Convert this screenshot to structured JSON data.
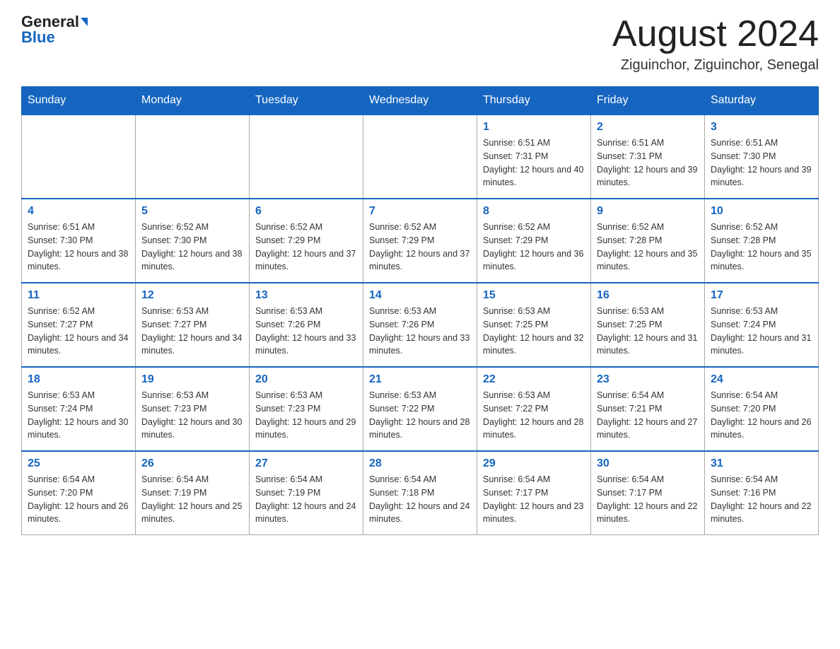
{
  "header": {
    "logo_general": "General",
    "logo_blue": "Blue",
    "month_title": "August 2024",
    "location": "Ziguinchor, Ziguinchor, Senegal"
  },
  "days_of_week": [
    "Sunday",
    "Monday",
    "Tuesday",
    "Wednesday",
    "Thursday",
    "Friday",
    "Saturday"
  ],
  "weeks": [
    {
      "days": [
        {
          "number": "",
          "info": ""
        },
        {
          "number": "",
          "info": ""
        },
        {
          "number": "",
          "info": ""
        },
        {
          "number": "",
          "info": ""
        },
        {
          "number": "1",
          "info": "Sunrise: 6:51 AM\nSunset: 7:31 PM\nDaylight: 12 hours and 40 minutes."
        },
        {
          "number": "2",
          "info": "Sunrise: 6:51 AM\nSunset: 7:31 PM\nDaylight: 12 hours and 39 minutes."
        },
        {
          "number": "3",
          "info": "Sunrise: 6:51 AM\nSunset: 7:30 PM\nDaylight: 12 hours and 39 minutes."
        }
      ]
    },
    {
      "days": [
        {
          "number": "4",
          "info": "Sunrise: 6:51 AM\nSunset: 7:30 PM\nDaylight: 12 hours and 38 minutes."
        },
        {
          "number": "5",
          "info": "Sunrise: 6:52 AM\nSunset: 7:30 PM\nDaylight: 12 hours and 38 minutes."
        },
        {
          "number": "6",
          "info": "Sunrise: 6:52 AM\nSunset: 7:29 PM\nDaylight: 12 hours and 37 minutes."
        },
        {
          "number": "7",
          "info": "Sunrise: 6:52 AM\nSunset: 7:29 PM\nDaylight: 12 hours and 37 minutes."
        },
        {
          "number": "8",
          "info": "Sunrise: 6:52 AM\nSunset: 7:29 PM\nDaylight: 12 hours and 36 minutes."
        },
        {
          "number": "9",
          "info": "Sunrise: 6:52 AM\nSunset: 7:28 PM\nDaylight: 12 hours and 35 minutes."
        },
        {
          "number": "10",
          "info": "Sunrise: 6:52 AM\nSunset: 7:28 PM\nDaylight: 12 hours and 35 minutes."
        }
      ]
    },
    {
      "days": [
        {
          "number": "11",
          "info": "Sunrise: 6:52 AM\nSunset: 7:27 PM\nDaylight: 12 hours and 34 minutes."
        },
        {
          "number": "12",
          "info": "Sunrise: 6:53 AM\nSunset: 7:27 PM\nDaylight: 12 hours and 34 minutes."
        },
        {
          "number": "13",
          "info": "Sunrise: 6:53 AM\nSunset: 7:26 PM\nDaylight: 12 hours and 33 minutes."
        },
        {
          "number": "14",
          "info": "Sunrise: 6:53 AM\nSunset: 7:26 PM\nDaylight: 12 hours and 33 minutes."
        },
        {
          "number": "15",
          "info": "Sunrise: 6:53 AM\nSunset: 7:25 PM\nDaylight: 12 hours and 32 minutes."
        },
        {
          "number": "16",
          "info": "Sunrise: 6:53 AM\nSunset: 7:25 PM\nDaylight: 12 hours and 31 minutes."
        },
        {
          "number": "17",
          "info": "Sunrise: 6:53 AM\nSunset: 7:24 PM\nDaylight: 12 hours and 31 minutes."
        }
      ]
    },
    {
      "days": [
        {
          "number": "18",
          "info": "Sunrise: 6:53 AM\nSunset: 7:24 PM\nDaylight: 12 hours and 30 minutes."
        },
        {
          "number": "19",
          "info": "Sunrise: 6:53 AM\nSunset: 7:23 PM\nDaylight: 12 hours and 30 minutes."
        },
        {
          "number": "20",
          "info": "Sunrise: 6:53 AM\nSunset: 7:23 PM\nDaylight: 12 hours and 29 minutes."
        },
        {
          "number": "21",
          "info": "Sunrise: 6:53 AM\nSunset: 7:22 PM\nDaylight: 12 hours and 28 minutes."
        },
        {
          "number": "22",
          "info": "Sunrise: 6:53 AM\nSunset: 7:22 PM\nDaylight: 12 hours and 28 minutes."
        },
        {
          "number": "23",
          "info": "Sunrise: 6:54 AM\nSunset: 7:21 PM\nDaylight: 12 hours and 27 minutes."
        },
        {
          "number": "24",
          "info": "Sunrise: 6:54 AM\nSunset: 7:20 PM\nDaylight: 12 hours and 26 minutes."
        }
      ]
    },
    {
      "days": [
        {
          "number": "25",
          "info": "Sunrise: 6:54 AM\nSunset: 7:20 PM\nDaylight: 12 hours and 26 minutes."
        },
        {
          "number": "26",
          "info": "Sunrise: 6:54 AM\nSunset: 7:19 PM\nDaylight: 12 hours and 25 minutes."
        },
        {
          "number": "27",
          "info": "Sunrise: 6:54 AM\nSunset: 7:19 PM\nDaylight: 12 hours and 24 minutes."
        },
        {
          "number": "28",
          "info": "Sunrise: 6:54 AM\nSunset: 7:18 PM\nDaylight: 12 hours and 24 minutes."
        },
        {
          "number": "29",
          "info": "Sunrise: 6:54 AM\nSunset: 7:17 PM\nDaylight: 12 hours and 23 minutes."
        },
        {
          "number": "30",
          "info": "Sunrise: 6:54 AM\nSunset: 7:17 PM\nDaylight: 12 hours and 22 minutes."
        },
        {
          "number": "31",
          "info": "Sunrise: 6:54 AM\nSunset: 7:16 PM\nDaylight: 12 hours and 22 minutes."
        }
      ]
    }
  ]
}
